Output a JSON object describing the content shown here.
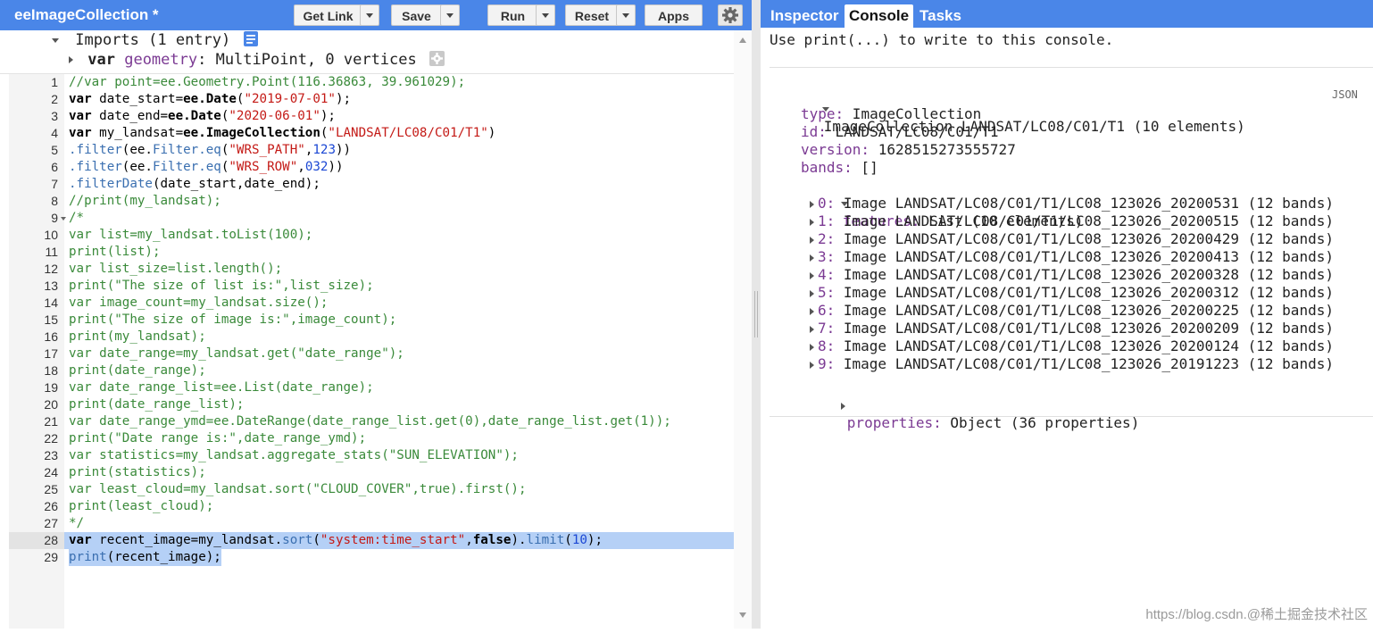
{
  "editor": {
    "title": "eeImageCollection *",
    "buttons": {
      "get_link": "Get Link",
      "save": "Save",
      "run": "Run",
      "reset": "Reset",
      "apps": "Apps"
    },
    "imports": {
      "summary": "Imports (1 entry)",
      "var_keyword": "var",
      "var_name": "geometry",
      "var_value": ": MultiPoint, 0 vertices"
    },
    "lines": [
      {
        "n": "1",
        "parts": [
          [
            "c-comment",
            "//var point=ee.Geometry.Point(116.36863, 39.961029);"
          ]
        ]
      },
      {
        "n": "2",
        "parts": [
          [
            "c-kw",
            "var"
          ],
          [
            "c-id",
            " date_start="
          ],
          [
            "c-kw",
            "ee.Date"
          ],
          [
            "c-id",
            "("
          ],
          [
            "c-str",
            "\"2019-07-01\""
          ],
          [
            "c-id",
            ");"
          ]
        ]
      },
      {
        "n": "3",
        "parts": [
          [
            "c-kw",
            "var"
          ],
          [
            "c-id",
            " date_end="
          ],
          [
            "c-kw",
            "ee.Date"
          ],
          [
            "c-id",
            "("
          ],
          [
            "c-str",
            "\"2020-06-01\""
          ],
          [
            "c-id",
            ");"
          ]
        ]
      },
      {
        "n": "4",
        "parts": [
          [
            "c-kw",
            "var"
          ],
          [
            "c-id",
            " my_landsat="
          ],
          [
            "c-kw",
            "ee.ImageCollection"
          ],
          [
            "c-id",
            "("
          ],
          [
            "c-str",
            "\"LANDSAT/LC08/C01/T1\""
          ],
          [
            "c-id",
            ")"
          ]
        ]
      },
      {
        "n": "5",
        "parts": [
          [
            "c-prop",
            ".filter"
          ],
          [
            "c-id",
            "(ee."
          ],
          [
            "c-prop",
            "Filter.eq"
          ],
          [
            "c-id",
            "("
          ],
          [
            "c-str",
            "\"WRS_PATH\""
          ],
          [
            "c-id",
            ","
          ],
          [
            "c-num",
            "123"
          ],
          [
            "c-id",
            "))"
          ]
        ]
      },
      {
        "n": "6",
        "parts": [
          [
            "c-prop",
            ".filter"
          ],
          [
            "c-id",
            "(ee."
          ],
          [
            "c-prop",
            "Filter.eq"
          ],
          [
            "c-id",
            "("
          ],
          [
            "c-str",
            "\"WRS_ROW\""
          ],
          [
            "c-id",
            ","
          ],
          [
            "c-num",
            "032"
          ],
          [
            "c-id",
            "))"
          ]
        ]
      },
      {
        "n": "7",
        "parts": [
          [
            "c-prop",
            ".filterDate"
          ],
          [
            "c-id",
            "(date_start,date_end);"
          ]
        ]
      },
      {
        "n": "8",
        "parts": [
          [
            "c-comment",
            "//print(my_landsat);"
          ]
        ]
      },
      {
        "n": "9",
        "fold": true,
        "parts": [
          [
            "c-comment",
            "/*"
          ]
        ]
      },
      {
        "n": "10",
        "parts": [
          [
            "c-comment",
            "var list=my_landsat.toList(100);"
          ]
        ]
      },
      {
        "n": "11",
        "parts": [
          [
            "c-comment",
            "print(list);"
          ]
        ]
      },
      {
        "n": "12",
        "parts": [
          [
            "c-comment",
            "var list_size=list.length();"
          ]
        ]
      },
      {
        "n": "13",
        "parts": [
          [
            "c-comment",
            "print(\"The size of list is:\",list_size);"
          ]
        ]
      },
      {
        "n": "14",
        "parts": [
          [
            "c-comment",
            "var image_count=my_landsat.size();"
          ]
        ]
      },
      {
        "n": "15",
        "parts": [
          [
            "c-comment",
            "print(\"The size of image is:\",image_count);"
          ]
        ]
      },
      {
        "n": "16",
        "parts": [
          [
            "c-comment",
            "print(my_landsat);"
          ]
        ]
      },
      {
        "n": "17",
        "parts": [
          [
            "c-comment",
            "var date_range=my_landsat.get(\"date_range\");"
          ]
        ]
      },
      {
        "n": "18",
        "parts": [
          [
            "c-comment",
            "print(date_range);"
          ]
        ]
      },
      {
        "n": "19",
        "parts": [
          [
            "c-comment",
            "var date_range_list=ee.List(date_range);"
          ]
        ]
      },
      {
        "n": "20",
        "parts": [
          [
            "c-comment",
            "print(date_range_list);"
          ]
        ]
      },
      {
        "n": "21",
        "parts": [
          [
            "c-comment",
            "var date_range_ymd=ee.DateRange(date_range_list.get(0),date_range_list.get(1));"
          ]
        ]
      },
      {
        "n": "22",
        "parts": [
          [
            "c-comment",
            "print(\"Date range is:\",date_range_ymd);"
          ]
        ]
      },
      {
        "n": "23",
        "parts": [
          [
            "c-comment",
            "var statistics=my_landsat.aggregate_stats(\"SUN_ELEVATION\");"
          ]
        ]
      },
      {
        "n": "24",
        "parts": [
          [
            "c-comment",
            "print(statistics);"
          ]
        ]
      },
      {
        "n": "25",
        "parts": [
          [
            "c-comment",
            "var least_cloud=my_landsat.sort(\"CLOUD_COVER\",true).first();"
          ]
        ]
      },
      {
        "n": "26",
        "parts": [
          [
            "c-comment",
            "print(least_cloud);"
          ]
        ]
      },
      {
        "n": "27",
        "parts": [
          [
            "c-comment",
            "*/"
          ]
        ]
      },
      {
        "n": "28",
        "hl": true,
        "parts": [
          [
            "c-kw",
            "var"
          ],
          [
            "c-id",
            " recent_image=my_landsat."
          ],
          [
            "c-prop",
            "sort"
          ],
          [
            "c-id",
            "("
          ],
          [
            "c-str",
            "\"system:time_start\""
          ],
          [
            "c-id",
            ","
          ],
          [
            "c-kw",
            "false"
          ],
          [
            "c-id",
            ")."
          ],
          [
            "c-prop",
            "limit"
          ],
          [
            "c-id",
            "("
          ],
          [
            "c-num",
            "10"
          ],
          [
            "c-id",
            ");"
          ]
        ]
      },
      {
        "n": "29",
        "hlpart": true,
        "parts": [
          [
            "c-prop",
            "print"
          ],
          [
            "c-id",
            "(recent_image);"
          ]
        ]
      }
    ]
  },
  "console": {
    "tabs": [
      "Inspector",
      "Console",
      "Tasks"
    ],
    "active_tab": "Console",
    "hint": "Use print(...) to write to this console.",
    "json_label": "JSON",
    "collection_header": "ImageCollection LANDSAT/LC08/C01/T1 (10 elements)",
    "fields": [
      {
        "key": "type:",
        "value": " ImageCollection"
      },
      {
        "key": "id:",
        "value": " LANDSAT/LC08/C01/T1"
      },
      {
        "key": "version:",
        "value": " 1628515273555727"
      },
      {
        "key": "bands:",
        "value": " []"
      }
    ],
    "features_key": "features:",
    "features_value": " List (10 elements)",
    "features": [
      {
        "key": "0:",
        "value": " Image LANDSAT/LC08/C01/T1/LC08_123026_20200531 (12 bands)"
      },
      {
        "key": "1:",
        "value": " Image LANDSAT/LC08/C01/T1/LC08_123026_20200515 (12 bands)"
      },
      {
        "key": "2:",
        "value": " Image LANDSAT/LC08/C01/T1/LC08_123026_20200429 (12 bands)"
      },
      {
        "key": "3:",
        "value": " Image LANDSAT/LC08/C01/T1/LC08_123026_20200413 (12 bands)"
      },
      {
        "key": "4:",
        "value": " Image LANDSAT/LC08/C01/T1/LC08_123026_20200328 (12 bands)"
      },
      {
        "key": "5:",
        "value": " Image LANDSAT/LC08/C01/T1/LC08_123026_20200312 (12 bands)"
      },
      {
        "key": "6:",
        "value": " Image LANDSAT/LC08/C01/T1/LC08_123026_20200225 (12 bands)"
      },
      {
        "key": "7:",
        "value": " Image LANDSAT/LC08/C01/T1/LC08_123026_20200209 (12 bands)"
      },
      {
        "key": "8:",
        "value": " Image LANDSAT/LC08/C01/T1/LC08_123026_20200124 (12 bands)"
      },
      {
        "key": "9:",
        "value": " Image LANDSAT/LC08/C01/T1/LC08_123026_20191223 (12 bands)"
      }
    ],
    "properties_key": "properties:",
    "properties_value": " Object (36 properties)"
  },
  "watermark": "https://blog.csdn.@稀土掘金技术社区",
  "colors": {
    "header_blue": "#4a86e8",
    "highlight": "#b5d0f6",
    "key_purple": "#7b3a93"
  }
}
